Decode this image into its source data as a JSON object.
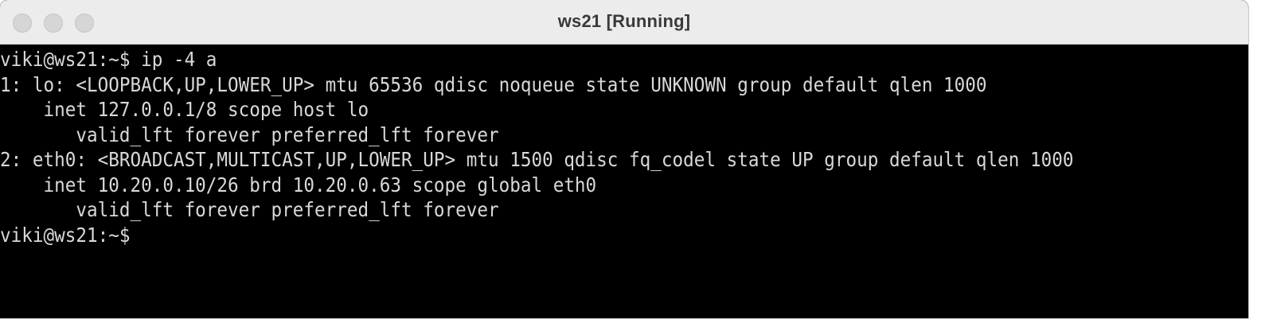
{
  "window": {
    "title": "ws21 [Running]",
    "buttons": [
      "close",
      "minimize",
      "maximize"
    ]
  },
  "terminal": {
    "lines": [
      "viki@ws21:~$ ip -4 a",
      "1: lo: <LOOPBACK,UP,LOWER_UP> mtu 65536 qdisc noqueue state UNKNOWN group default qlen 1000",
      "    inet 127.0.0.1/8 scope host lo",
      "       valid_lft forever preferred_lft forever",
      "2: eth0: <BROADCAST,MULTICAST,UP,LOWER_UP> mtu 1500 qdisc fq_codel state UP group default qlen 1000",
      "    inet 10.20.0.10/26 brd 10.20.0.63 scope global eth0",
      "       valid_lft forever preferred_lft forever",
      "viki@ws21:~$"
    ]
  },
  "colors": {
    "terminal_bg": "#000000",
    "terminal_fg": "#d8d8d8",
    "titlebar_bg": "#ececec",
    "title_text": "#3a3a3a",
    "traffic_light": "#d6d6d6"
  }
}
